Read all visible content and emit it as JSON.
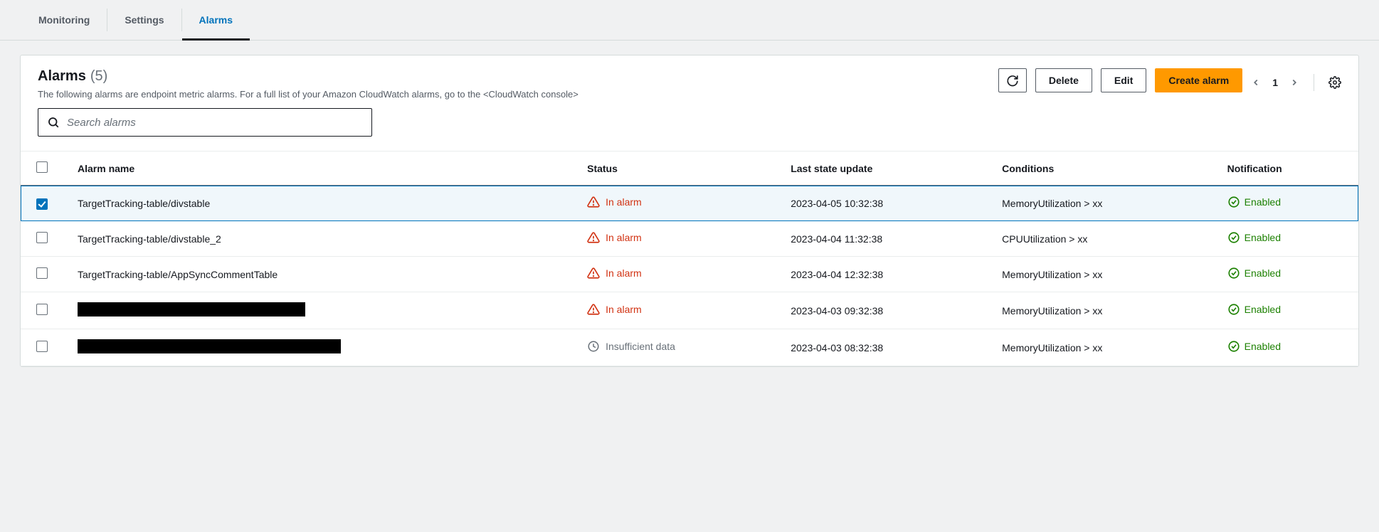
{
  "tabs": [
    {
      "label": "Monitoring",
      "active": false
    },
    {
      "label": "Settings",
      "active": false
    },
    {
      "label": "Alarms",
      "active": true
    }
  ],
  "panel": {
    "title": "Alarms",
    "count": "(5)",
    "description_pre": "The following alarms are endpoint metric alarms. For a full list of your Amazon CloudWatch alarms, go to the ",
    "description_link": "<CloudWatch console>"
  },
  "buttons": {
    "delete": "Delete",
    "edit": "Edit",
    "create": "Create alarm"
  },
  "pager": {
    "page": "1"
  },
  "search": {
    "placeholder": "Search alarms"
  },
  "columns": {
    "name": "Alarm name",
    "status": "Status",
    "updated": "Last state update",
    "conditions": "Conditions",
    "notification": "Notification"
  },
  "status_labels": {
    "in_alarm": "In alarm",
    "insufficient": "Insufficient data"
  },
  "notification_label": "Enabled",
  "rows": [
    {
      "selected": true,
      "name": "TargetTracking-table/divstable",
      "redacted": false,
      "status": "in_alarm",
      "updated": "2023-04-05 10:32:38",
      "conditions": "MemoryUtilization > xx",
      "notification": "Enabled"
    },
    {
      "selected": false,
      "name": "TargetTracking-table/divstable_2",
      "redacted": false,
      "status": "in_alarm",
      "updated": "2023-04-04 11:32:38",
      "conditions": "CPUUtilization > xx",
      "notification": "Enabled"
    },
    {
      "selected": false,
      "name": "TargetTracking-table/AppSyncCommentTable",
      "redacted": false,
      "status": "in_alarm",
      "updated": "2023-04-04 12:32:38",
      "conditions": "MemoryUtilization > xx",
      "notification": "Enabled"
    },
    {
      "selected": false,
      "name": "",
      "redacted": true,
      "redacted_class": "w1",
      "status": "in_alarm",
      "updated": "2023-04-03 09:32:38",
      "conditions": "MemoryUtilization > xx",
      "notification": "Enabled"
    },
    {
      "selected": false,
      "name": "",
      "redacted": true,
      "redacted_class": "w2",
      "status": "insufficient",
      "updated": "2023-04-03 08:32:38",
      "conditions": "MemoryUtilization > xx",
      "notification": "Enabled"
    }
  ]
}
